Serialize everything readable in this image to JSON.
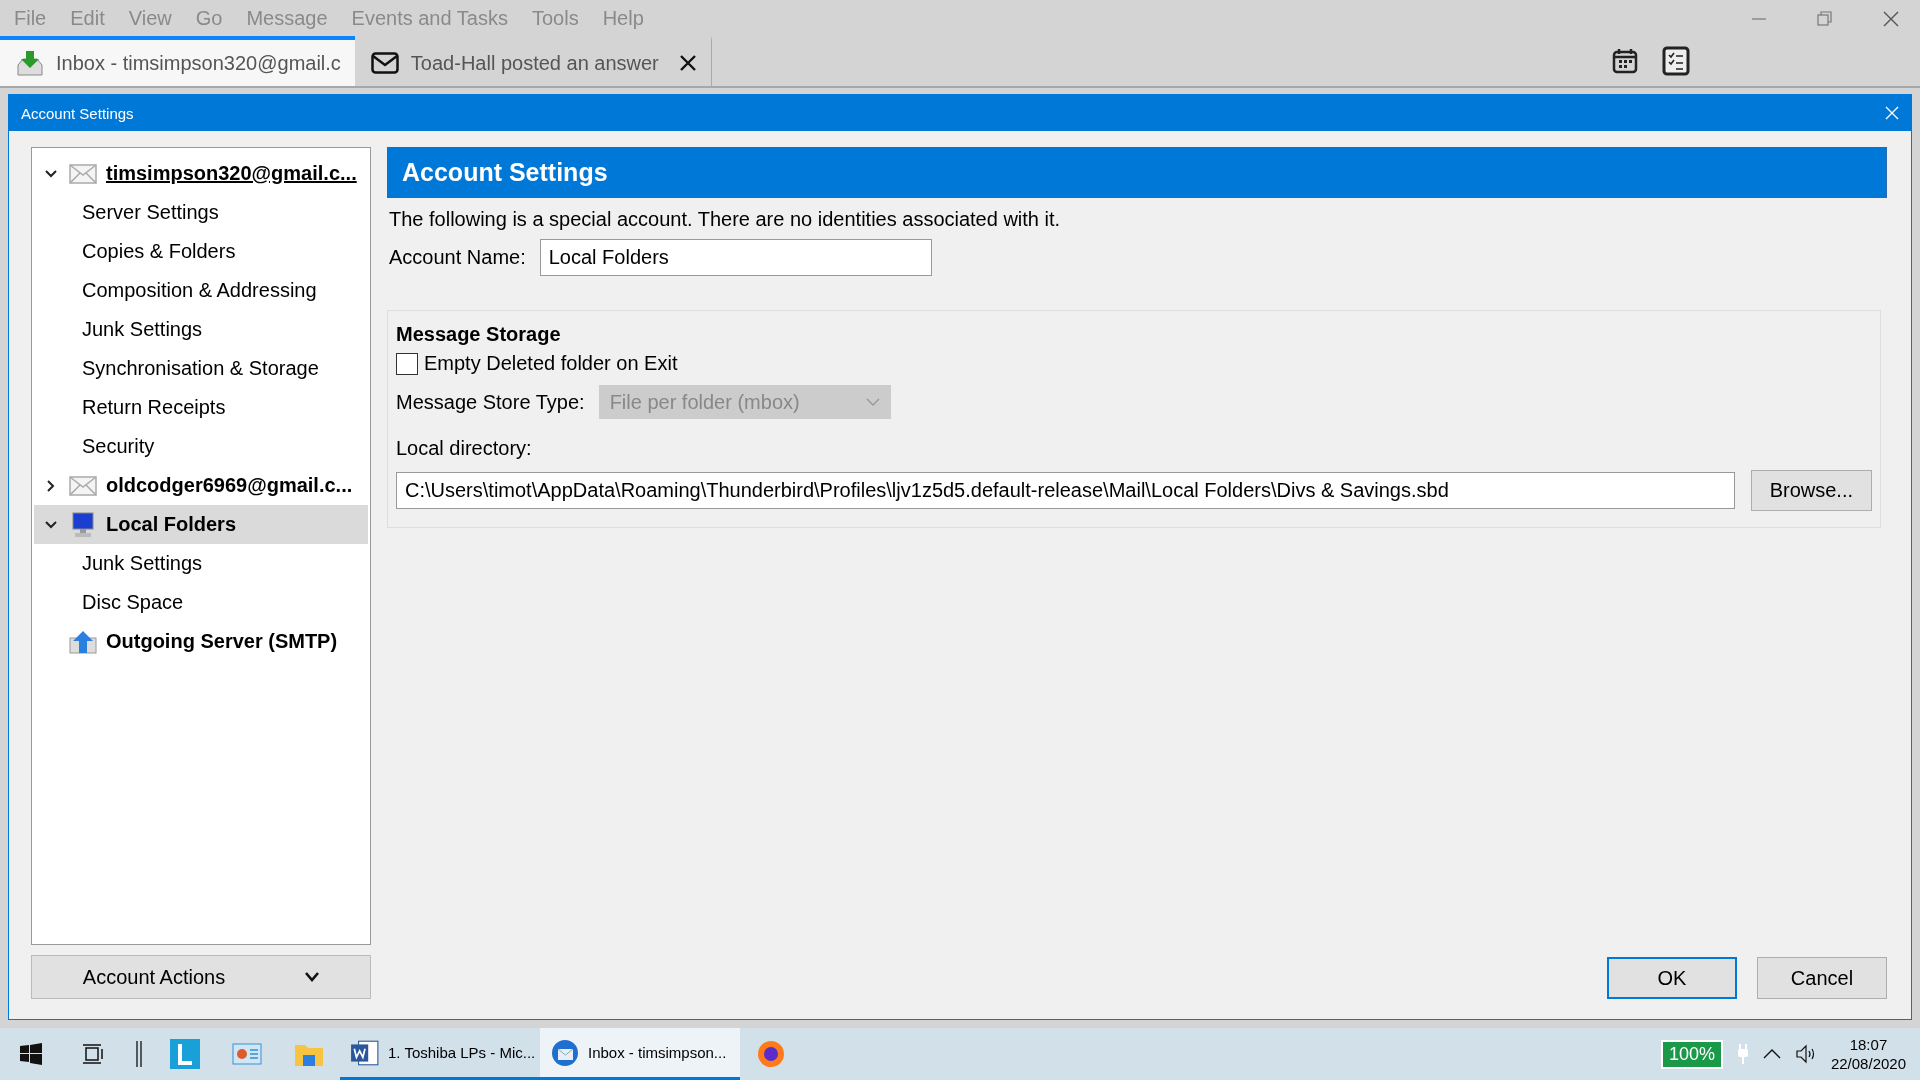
{
  "menu": [
    "File",
    "Edit",
    "View",
    "Go",
    "Message",
    "Events and Tasks",
    "Tools",
    "Help"
  ],
  "tabs": [
    {
      "label": "Inbox - timsimpson320@gmail.c",
      "kind": "inbox",
      "selected": true,
      "closable": false
    },
    {
      "label": "Toad-Hall posted an answer",
      "kind": "mail",
      "selected": false,
      "closable": true
    }
  ],
  "dialog": {
    "title": "Account Settings"
  },
  "tree": [
    {
      "label": "timsimpson320@gmail.c...",
      "kind": "mail",
      "expandable": true,
      "expanded": true,
      "selected": false,
      "focused": true,
      "children": [
        {
          "label": "Server Settings",
          "selected": false
        },
        {
          "label": "Copies & Folders",
          "selected": false
        },
        {
          "label": "Composition & Addressing",
          "selected": false
        },
        {
          "label": "Junk Settings",
          "selected": false
        },
        {
          "label": "Synchronisation & Storage",
          "selected": false
        },
        {
          "label": "Return Receipts",
          "selected": false
        },
        {
          "label": "Security",
          "selected": false
        }
      ]
    },
    {
      "label": "oldcodger6969@gmail.c...",
      "kind": "mail",
      "expandable": true,
      "expanded": false,
      "selected": false,
      "focused": false
    },
    {
      "label": "Local Folders",
      "kind": "computer",
      "expandable": true,
      "expanded": true,
      "selected": true,
      "focused": false,
      "children": [
        {
          "label": "Junk Settings",
          "selected": false
        },
        {
          "label": "Disc Space",
          "selected": false
        }
      ]
    },
    {
      "label": "Outgoing Server (SMTP)",
      "kind": "server",
      "expandable": false,
      "expanded": false,
      "selected": false,
      "focused": false
    }
  ],
  "account_actions": {
    "label": "Account Actions"
  },
  "panel": {
    "header": "Account Settings",
    "note": "The following is a special account. There are no identities associated with it.",
    "account_name": {
      "label": "Account Name:",
      "value": "Local Folders"
    },
    "storage": {
      "title": "Message Storage",
      "empty_on_exit": {
        "label": "Empty Deleted folder on Exit",
        "checked": false
      },
      "store_type": {
        "label": "Message Store Type:",
        "value": "File per folder (mbox)",
        "disabled": true
      },
      "local_dir": {
        "label": "Local directory:",
        "value": "C:\\Users\\timot\\AppData\\Roaming\\Thunderbird\\Profiles\\ljv1z5d5.default-release\\Mail\\Local Folders\\Divs & Savings.sbd"
      },
      "browse": "Browse..."
    }
  },
  "buttons": [
    {
      "label": "OK",
      "default": true
    },
    {
      "label": "Cancel",
      "default": false
    }
  ],
  "taskbar": {
    "apps": [
      {
        "kind": "word",
        "label": "1. Toshiba LPs - Mic...",
        "selected": false
      },
      {
        "kind": "thunderbird",
        "label": "Inbox - timsimpson...",
        "selected": true
      }
    ],
    "battery": "100%",
    "time": "18:07",
    "date": "22/08/2020"
  }
}
